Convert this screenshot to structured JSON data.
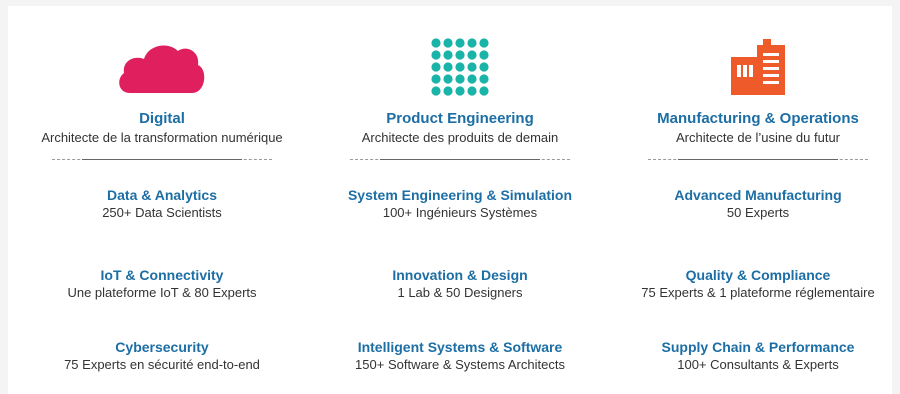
{
  "colors": {
    "heading": "#1c6ea4",
    "text": "#333333",
    "cloud": "#e0205e",
    "dots": "#19b3a8",
    "factory": "#ef5a2a"
  },
  "columns": [
    {
      "icon": "cloud-icon",
      "title": "Digital",
      "subtitle": "Architecte de la transformation numérique",
      "items": [
        {
          "title": "Data & Analytics",
          "desc": "250+ Data Scientists"
        },
        {
          "title": "IoT & Connectivity",
          "desc": "Une plateforme IoT & 80 Experts"
        },
        {
          "title": "Cybersecurity",
          "desc": "75 Experts en sécurité end-to-end"
        }
      ]
    },
    {
      "icon": "dot-grid-icon",
      "title": "Product Engineering",
      "subtitle": "Architecte des produits de demain",
      "items": [
        {
          "title": "System Engineering & Simulation",
          "desc": "100+ Ingénieurs Systèmes"
        },
        {
          "title": "Innovation & Design",
          "desc": "1 Lab & 50 Designers"
        },
        {
          "title": "Intelligent Systems & Software",
          "desc": "150+ Software & Systems Architects"
        }
      ]
    },
    {
      "icon": "factory-icon",
      "title": "Manufacturing & Operations",
      "subtitle": "Architecte de l’usine du futur",
      "items": [
        {
          "title": "Advanced Manufacturing",
          "desc": "50 Experts"
        },
        {
          "title": "Quality & Compliance",
          "desc": "75 Experts & 1 plateforme réglementaire"
        },
        {
          "title": "Supply Chain & Performance",
          "desc": "100+ Consultants & Experts"
        }
      ]
    }
  ]
}
